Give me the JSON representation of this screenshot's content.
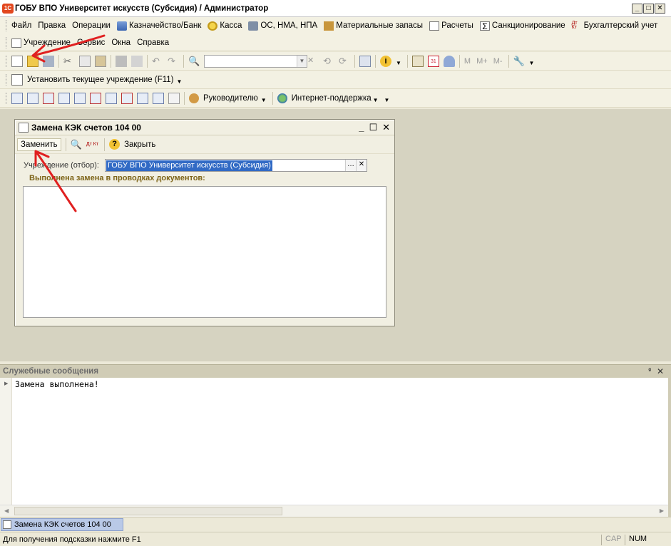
{
  "window": {
    "title": "ГОБУ ВПО Университет искусств (Субсидия) / Администратор",
    "logo": "1C"
  },
  "menu": {
    "row1": [
      "Файл",
      "Правка",
      "Операции",
      "Казначейство/Банк",
      "Касса",
      "ОС, НМА, НПА",
      "Материальные запасы",
      "Расчеты",
      "Санкционирование",
      "Бухгалтерский учет"
    ],
    "row2": [
      "Учреждение",
      "Сервис",
      "Окна",
      "Справка"
    ]
  },
  "toolbar3": {
    "set_institution": "Установить текущее учреждение (F11)"
  },
  "toolbar4": {
    "manager": "Руководителю",
    "support": "Интернет-поддержка"
  },
  "memory_buttons": [
    "M",
    "M+",
    "M-"
  ],
  "child": {
    "title": "Замена КЭК счетов 104 00",
    "replace": "Заменить",
    "close": "Закрыть",
    "dt_kt": "Дт Кт",
    "field_label": "Учреждение (отбор):",
    "field_value": "ГОБУ ВПО Университет искусств (Субсидия)",
    "done_text": "Выполнена замена в проводках документов:"
  },
  "messages": {
    "header": "Служебные сообщения",
    "line1": "Замена выполнена!"
  },
  "taskbar": {
    "item": "Замена КЭК счетов 104 00"
  },
  "status": {
    "hint": "Для получения подсказки нажмите F1",
    "cap": "CAP",
    "num": "NUM"
  },
  "colors": {
    "selection": "#316ac5",
    "annotation_arrow": "#e02020",
    "done_label": "#7d6418"
  }
}
